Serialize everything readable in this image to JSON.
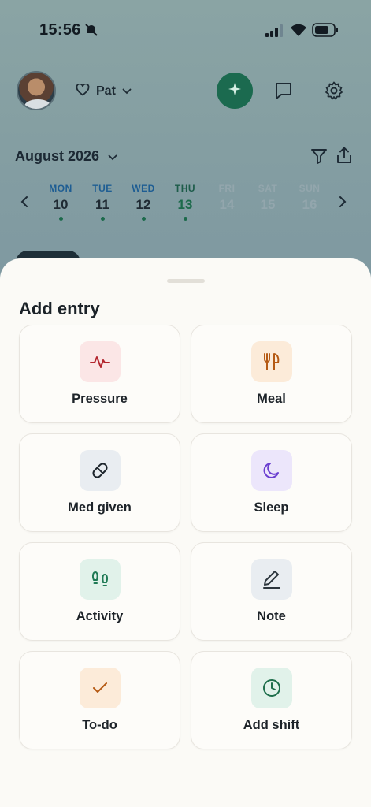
{
  "status": {
    "time": "15:56"
  },
  "header": {
    "profile_name": "Pat"
  },
  "calendar": {
    "month": "August 2026",
    "days": [
      {
        "dow": "MON",
        "num": "10",
        "state": "past",
        "has_entry": true
      },
      {
        "dow": "TUE",
        "num": "11",
        "state": "past",
        "has_entry": true
      },
      {
        "dow": "WED",
        "num": "12",
        "state": "past",
        "has_entry": true
      },
      {
        "dow": "THU",
        "num": "13",
        "state": "today",
        "has_entry": true
      },
      {
        "dow": "FRI",
        "num": "14",
        "state": "future",
        "has_entry": false
      },
      {
        "dow": "SAT",
        "num": "15",
        "state": "future",
        "has_entry": false
      },
      {
        "dow": "SUN",
        "num": "16",
        "state": "future",
        "has_entry": false
      }
    ]
  },
  "sheet": {
    "title": "Add entry",
    "items": [
      {
        "label": "Pressure",
        "icon": "pulse-icon",
        "bg": "#fbe6e6",
        "color": "#b3262e"
      },
      {
        "label": "Meal",
        "icon": "utensils-icon",
        "bg": "#fcebd9",
        "color": "#b55a14"
      },
      {
        "label": "Med given",
        "icon": "pill-icon",
        "bg": "#e9edf1",
        "color": "#1e262d"
      },
      {
        "label": "Sleep",
        "icon": "moon-icon",
        "bg": "#ece6fb",
        "color": "#6b3fd0"
      },
      {
        "label": "Activity",
        "icon": "footprints-icon",
        "bg": "#e1f2ea",
        "color": "#1f7a55"
      },
      {
        "label": "Note",
        "icon": "pencil-icon",
        "bg": "#e9edf1",
        "color": "#2d363d"
      },
      {
        "label": "To-do",
        "icon": "check-icon",
        "bg": "#fcebd9",
        "color": "#b55a14"
      },
      {
        "label": "Add shift",
        "icon": "clock-icon",
        "bg": "#e1f2ea",
        "color": "#1f6f4c"
      }
    ]
  },
  "colors": {
    "accent": "#1b6a4f",
    "sheet_bg": "#fbfaf6"
  }
}
